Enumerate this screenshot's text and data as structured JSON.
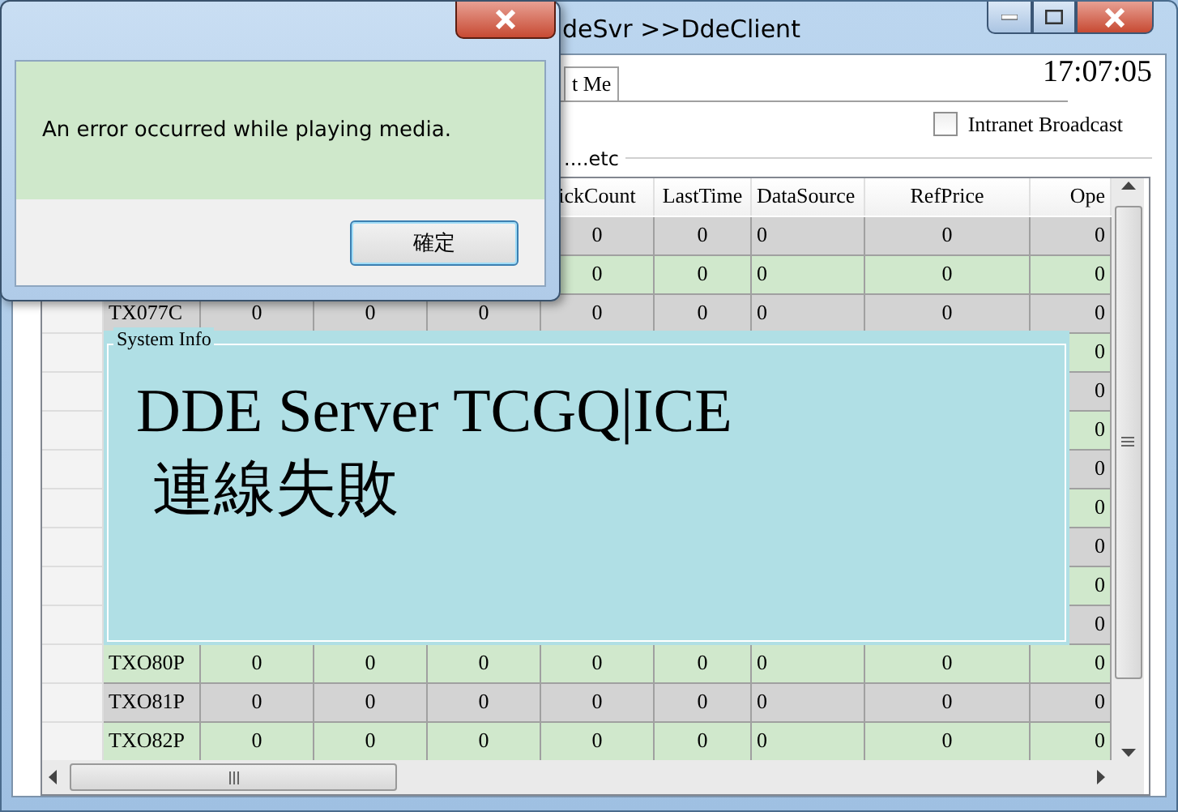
{
  "window": {
    "title": "deSvr >>DdeClient"
  },
  "tabs": [
    {
      "label": "t Me",
      "selected": true
    }
  ],
  "clock": "17:07:05",
  "intranet_broadcast": {
    "label": "Intranet Broadcast",
    "checked": false
  },
  "group_label": "....etc",
  "grid": {
    "columns": [
      null,
      null,
      null,
      null,
      "ickCount",
      "LastTime",
      "DataSource",
      "RefPrice",
      "Ope"
    ],
    "rows": [
      {
        "cells": [
          null,
          null,
          null,
          null,
          "0",
          "0",
          "0",
          "0",
          "0"
        ]
      },
      {
        "cells": [
          null,
          null,
          null,
          null,
          "0",
          "0",
          "0",
          "0",
          "0"
        ]
      },
      {
        "cells": [
          "TX077C",
          "0",
          "0",
          "0",
          "0",
          "0",
          "0",
          "0",
          "0"
        ]
      },
      {
        "cells": [
          null,
          null,
          null,
          null,
          null,
          null,
          null,
          null,
          "0"
        ]
      },
      {
        "cells": [
          null,
          null,
          null,
          null,
          null,
          null,
          null,
          null,
          "0"
        ]
      },
      {
        "cells": [
          null,
          null,
          null,
          null,
          null,
          null,
          null,
          null,
          "0"
        ]
      },
      {
        "cells": [
          null,
          null,
          null,
          null,
          null,
          null,
          null,
          null,
          "0"
        ]
      },
      {
        "cells": [
          null,
          null,
          null,
          null,
          null,
          null,
          null,
          null,
          "0"
        ]
      },
      {
        "cells": [
          null,
          null,
          null,
          null,
          null,
          null,
          null,
          null,
          "0"
        ]
      },
      {
        "cells": [
          null,
          null,
          null,
          null,
          null,
          null,
          null,
          null,
          "0"
        ]
      },
      {
        "cells": [
          null,
          null,
          null,
          null,
          null,
          null,
          null,
          null,
          "0"
        ]
      },
      {
        "cells": [
          "TXO80P",
          "0",
          "0",
          "0",
          "0",
          "0",
          "0",
          "0",
          "0"
        ]
      },
      {
        "cells": [
          "TXO81P",
          "0",
          "0",
          "0",
          "0",
          "0",
          "0",
          "0",
          "0"
        ]
      },
      {
        "cells": [
          "TXO82P",
          "0",
          "0",
          "0",
          "0",
          "0",
          "0",
          "0",
          "0"
        ]
      }
    ]
  },
  "system_info": {
    "title": "System Info",
    "lines": [
      "DDE Server TCGQ|ICE",
      "連線失敗"
    ]
  },
  "dialog": {
    "message": "An error occurred while playing media.",
    "buttons": [
      "確定"
    ]
  }
}
